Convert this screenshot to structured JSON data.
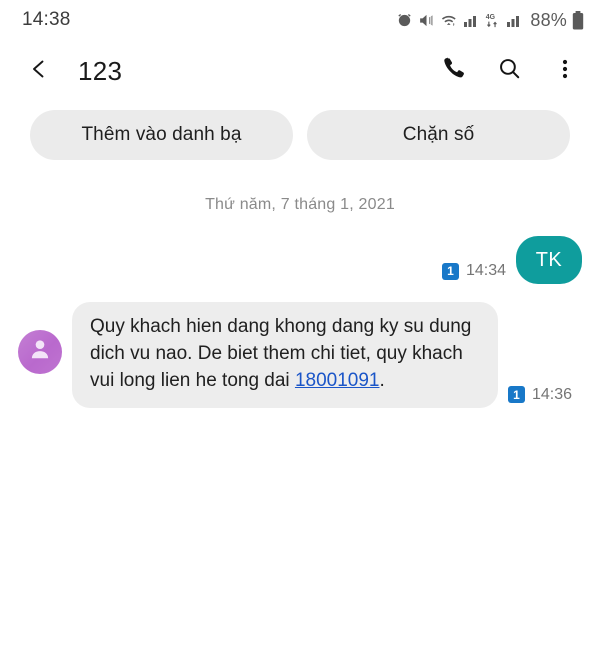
{
  "status_bar": {
    "clock": "14:38",
    "battery_percent": "88%",
    "icons": [
      "alarm-clock-icon",
      "mute-vibrate-icon",
      "wifi-transfer-icon",
      "signal-bars-icon",
      "network-4g-icon",
      "signal-bars-2-icon",
      "battery-icon"
    ]
  },
  "app_bar": {
    "title": "123",
    "back_icon": "chevron-left-icon",
    "call_icon": "phone-icon",
    "search_icon": "search-icon",
    "more_icon": "more-vertical-icon"
  },
  "quick_actions": {
    "add_contact_label": "Thêm vào danh bạ",
    "block_number_label": "Chặn số"
  },
  "conversation": {
    "date_divider": "Thứ năm, 7 tháng 1, 2021",
    "messages": [
      {
        "direction": "outgoing",
        "text": "TK",
        "sim_badge": "1",
        "time": "14:34"
      },
      {
        "direction": "incoming",
        "text_before_link": "Quy khach hien dang khong dang ky su dung dich vu nao. De biet them chi tiet, quy khach vui long lien he tong dai ",
        "link_text": "18001091",
        "text_after_link": ".",
        "sim_badge": "1",
        "time": "14:36",
        "avatar_icon": "person-avatar-icon"
      }
    ]
  },
  "colors": {
    "outgoing_bubble": "#0f9d9d",
    "incoming_bubble": "#ededed",
    "pill_background": "#ebebeb",
    "link": "#1a55c8",
    "sim_badge": "#1878c8",
    "avatar": "#bf74d1"
  }
}
